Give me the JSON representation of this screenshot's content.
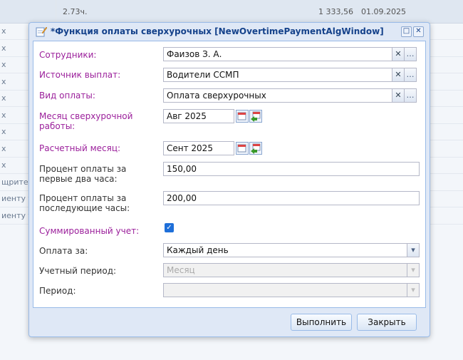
{
  "background": {
    "header_cells": [
      "2.73ч.",
      "1 333,56",
      "01.09.2025"
    ],
    "rows": [
      {
        "c0": "х"
      },
      {
        "c0": "х"
      },
      {
        "c0": "х"
      },
      {
        "c0": "х"
      },
      {
        "c0": "х"
      },
      {
        "c0": "х"
      },
      {
        "c0": "х"
      },
      {
        "c0": "х"
      },
      {
        "c0": "х"
      },
      {
        "c0": "щрител"
      },
      {
        "c0": "иенту т"
      },
      {
        "c0": "иенту т"
      }
    ]
  },
  "window": {
    "title": "*Функция оплаты сверхурочных [NewOvertimePaymentAlgWindow]",
    "maximize_icon": "□",
    "close_icon": "✕"
  },
  "form": {
    "employees": {
      "label": "Сотрудники:",
      "value": "Фаизов З. А."
    },
    "source": {
      "label": "Источник выплат:",
      "value": "Водители ССМП"
    },
    "pay_type": {
      "label": "Вид оплаты:",
      "value": "Оплата сверхурочных"
    },
    "overtime_month": {
      "label_line1": "Месяц сверхурочной",
      "label_line2": "работы:",
      "value": "Авг 2025"
    },
    "calc_month": {
      "label": "Расчетный месяц:",
      "value": "Сент 2025"
    },
    "pct_first": {
      "label_line1": "Процент оплаты за",
      "label_line2": "первые два часа:",
      "value": "150,00"
    },
    "pct_next": {
      "label_line1": "Процент оплаты за",
      "label_line2": "последующие часы:",
      "value": "200,00"
    },
    "summed": {
      "label": "Суммированный учет:",
      "checked": true,
      "check_glyph": "✓"
    },
    "pay_for": {
      "label": "Оплата за:",
      "value": "Каждый день"
    },
    "account_period": {
      "label": "Учетный период:",
      "placeholder": "Месяц"
    },
    "period": {
      "label": "Период:",
      "value": ""
    },
    "clear_glyph": "✕",
    "more_glyph": "…",
    "dropdown_glyph": "▾"
  },
  "footer": {
    "run_label": "Выполнить",
    "close_label": "Закрыть"
  },
  "colors": {
    "required_label": "#9b1f9b",
    "window_border": "#99bbe8",
    "title_text": "#15428b",
    "checkbox": "#1e6fd9"
  }
}
